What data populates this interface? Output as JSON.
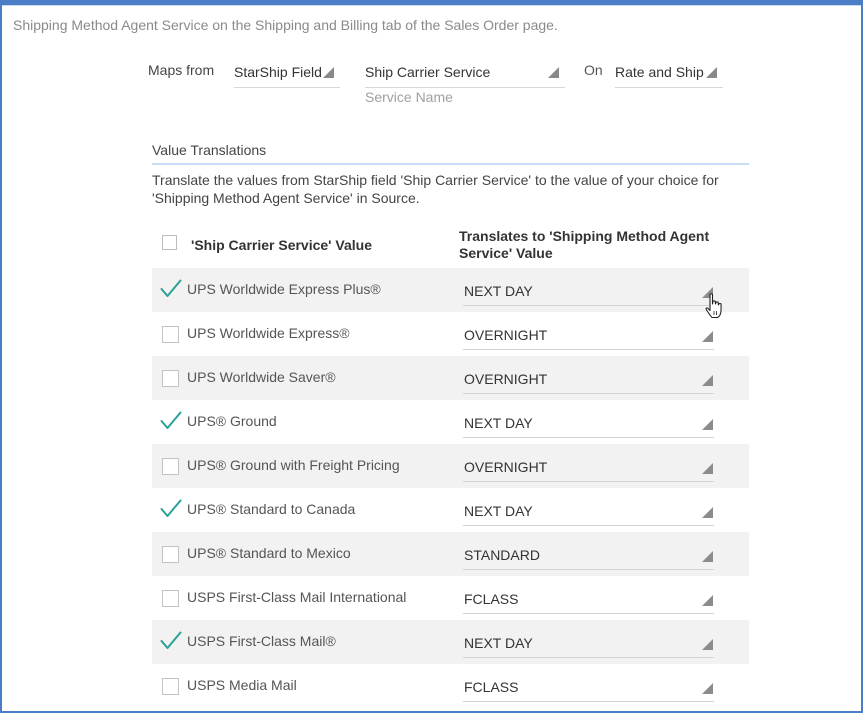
{
  "breadcrumb": "Shipping Method Agent Service on the Shipping and Billing tab of the Sales Order page.",
  "mapping": {
    "maps_from_label": "Maps from",
    "source_type": "StarShip Field",
    "source_field": "Ship Carrier Service",
    "source_field_subtitle": "Service Name",
    "on_label": "On",
    "event": "Rate and Ship"
  },
  "value_translations": {
    "title": "Value Translations",
    "description": "Translate the values from StarShip field 'Ship Carrier Service' to the value of your choice for 'Shipping Method Agent Service' in Source.",
    "col1_header": "'Ship Carrier Service' Value",
    "col2_header": "Translates to 'Shipping Method Agent Service' Value",
    "rows": [
      {
        "label": "UPS Worldwide Express Plus®",
        "checked": true,
        "value": "NEXT DAY"
      },
      {
        "label": "UPS Worldwide Express®",
        "checked": false,
        "value": "OVERNIGHT"
      },
      {
        "label": "UPS Worldwide Saver®",
        "checked": false,
        "value": "OVERNIGHT"
      },
      {
        "label": "UPS® Ground",
        "checked": true,
        "value": "NEXT DAY"
      },
      {
        "label": "UPS® Ground with Freight Pricing",
        "checked": false,
        "value": "OVERNIGHT"
      },
      {
        "label": "UPS® Standard to Canada",
        "checked": true,
        "value": "NEXT DAY"
      },
      {
        "label": "UPS® Standard to Mexico",
        "checked": false,
        "value": "STANDARD"
      },
      {
        "label": "USPS First-Class Mail International",
        "checked": false,
        "value": "FCLASS"
      },
      {
        "label": "USPS First-Class Mail®",
        "checked": true,
        "value": "NEXT DAY"
      },
      {
        "label": "USPS Media Mail",
        "checked": false,
        "value": "FCLASS"
      }
    ]
  },
  "colors": {
    "frame": "#4a7fc8",
    "checkmark": "#2aa198",
    "row_alt_bg": "#f2f2f2",
    "section_underline": "#c8dcf5"
  },
  "icons": {
    "dropdown": "triangle-dropdown-icon",
    "check": "checkmark-icon",
    "cursor": "hand-pointer-cursor-icon"
  }
}
